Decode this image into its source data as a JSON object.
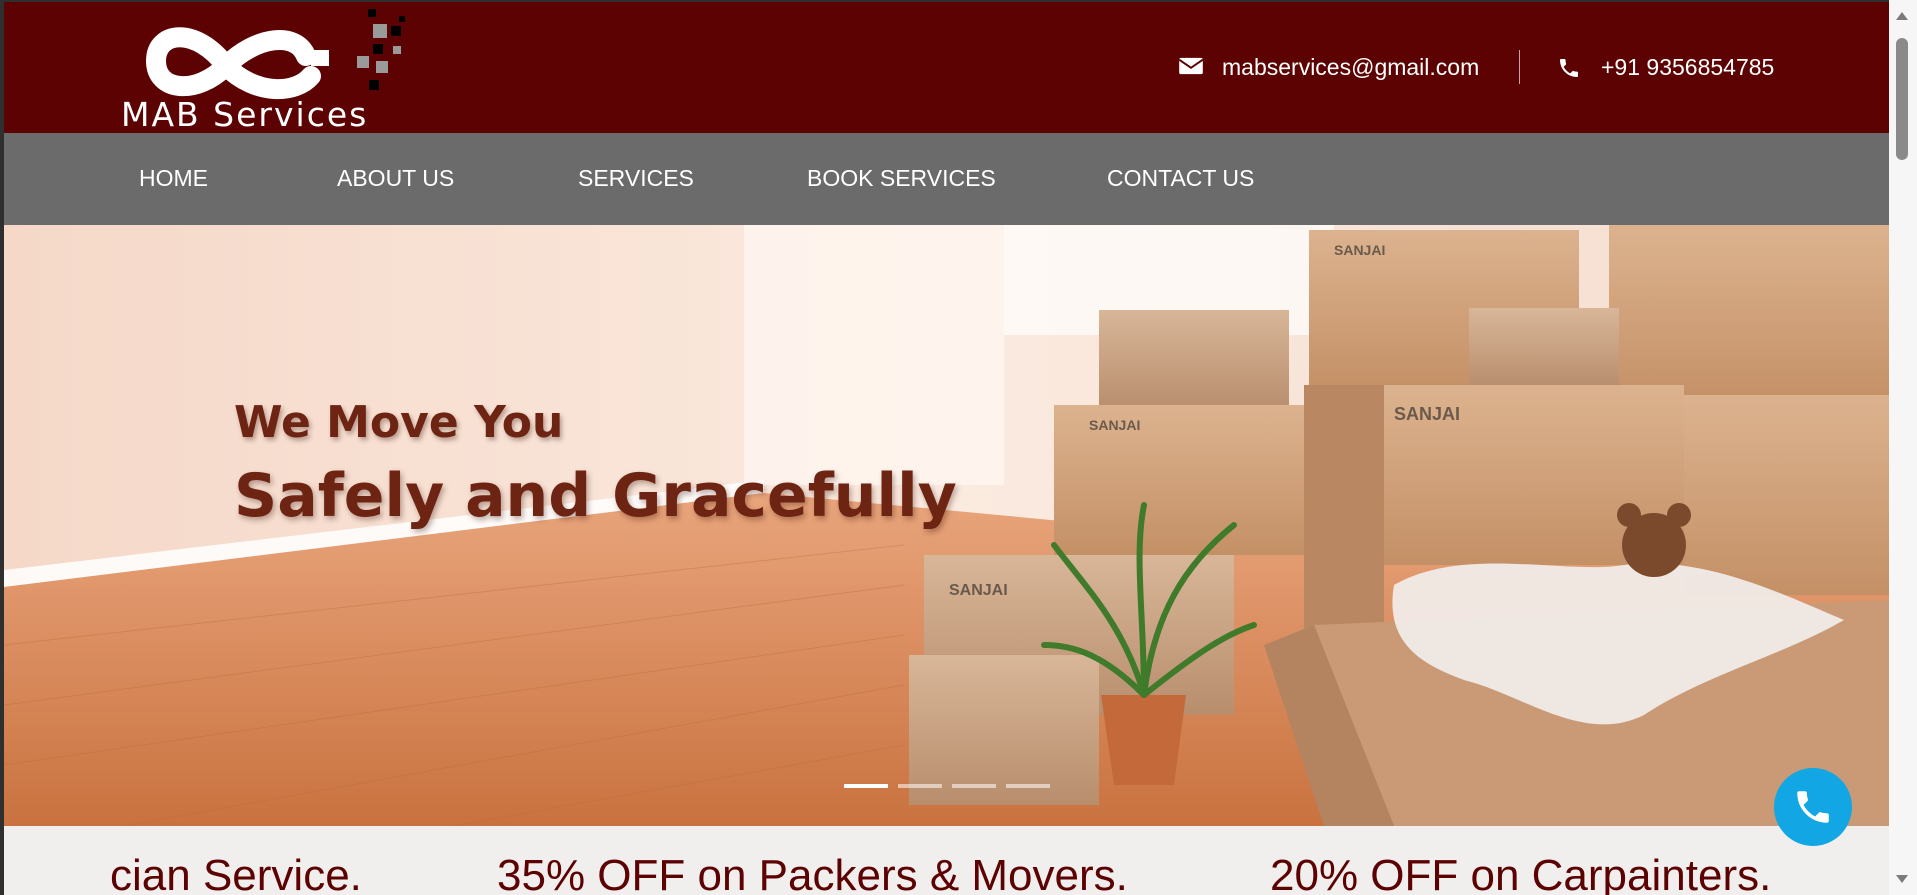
{
  "header": {
    "logo_text": "MAB Services",
    "email": "mabservices@gmail.com",
    "phone": "+91 9356854785",
    "icons": {
      "email": "envelope-icon",
      "phone": "phone-icon"
    },
    "colors": {
      "topbar": "#5c0202",
      "nav": "#6b6b6b",
      "accent": "#12a6e4"
    }
  },
  "nav": {
    "items": [
      {
        "label": "HOME"
      },
      {
        "label": "ABOUT US"
      },
      {
        "label": "SERVICES"
      },
      {
        "label": "BOOK SERVICES"
      },
      {
        "label": "CONTACT US"
      }
    ]
  },
  "hero": {
    "line1": "We Move You",
    "line2": "Safely and Gracefully",
    "box_brand": "SANJAI",
    "slide_count": 4,
    "active_slide": 1
  },
  "ticker": {
    "items": [
      "cian Service.",
      "35% OFF on Packers & Movers.",
      "20% OFF on Carpainters."
    ]
  },
  "call_button": {
    "icon": "phone-icon"
  }
}
